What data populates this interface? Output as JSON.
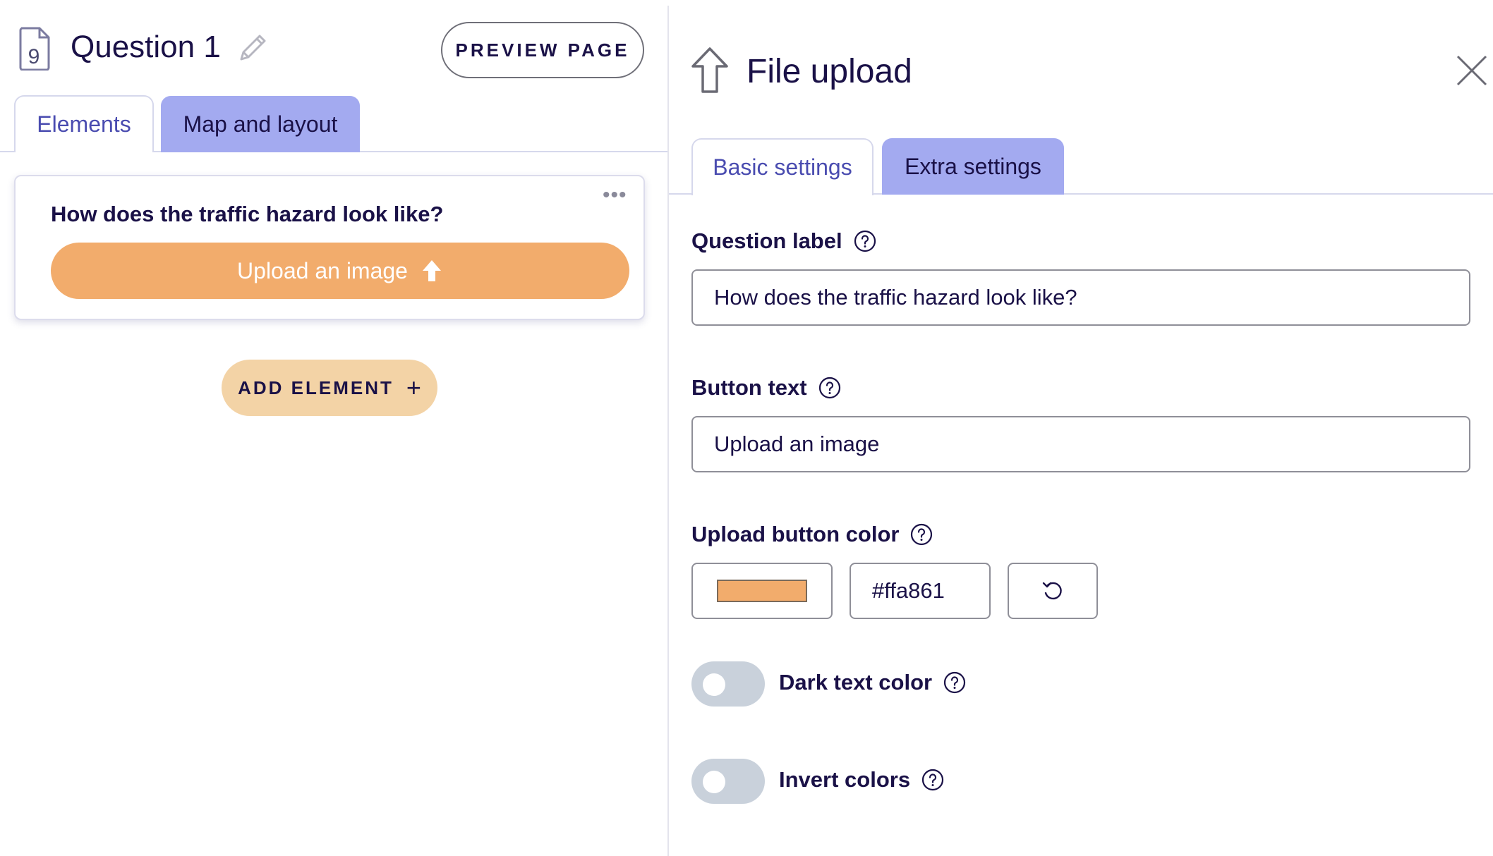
{
  "left": {
    "page_title": "Question 1",
    "preview_button": "PREVIEW PAGE",
    "tabs": [
      {
        "label": "Elements",
        "active": true
      },
      {
        "label": "Map and layout",
        "active": false
      }
    ],
    "element_card": {
      "question": "How does the traffic hazard look like?",
      "upload_button_label": "Upload an image",
      "menu_icon": "ellipsis-icon"
    },
    "add_element": {
      "label": "ADD ELEMENT",
      "plus": "+"
    }
  },
  "right": {
    "panel_title": "File upload",
    "tabs": [
      {
        "label": "Basic settings",
        "active": true
      },
      {
        "label": "Extra settings",
        "active": false
      }
    ],
    "fields": {
      "question_label": {
        "label": "Question label",
        "value": "How does the traffic hazard look like?"
      },
      "button_text": {
        "label": "Button text",
        "value": "Upload an image"
      },
      "upload_button_color": {
        "label": "Upload button color",
        "hex": "#ffa861"
      },
      "dark_text_color": {
        "label": "Dark text color",
        "on": false
      },
      "invert_colors": {
        "label": "Invert colors",
        "on": false
      }
    }
  },
  "colors": {
    "tab_inactive": "#a3aaf0",
    "upload_preview": "#f2ac6c",
    "swatch": "#f2ac6c",
    "add_element": "#f3d3a6",
    "text_primary": "#1a1147",
    "toggle_off": "#c9d1db"
  }
}
